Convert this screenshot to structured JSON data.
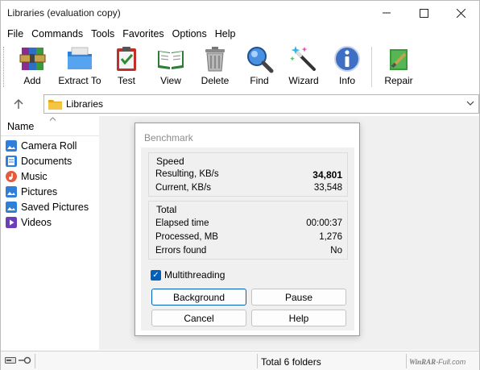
{
  "window": {
    "title": "Libraries (evaluation copy)"
  },
  "menu": [
    "File",
    "Commands",
    "Tools",
    "Favorites",
    "Options",
    "Help"
  ],
  "toolbar": [
    {
      "label": "Add",
      "icon": "add-archive-icon"
    },
    {
      "label": "Extract To",
      "icon": "extract-folder-icon"
    },
    {
      "label": "Test",
      "icon": "test-clipboard-icon"
    },
    {
      "label": "View",
      "icon": "view-book-icon"
    },
    {
      "label": "Delete",
      "icon": "trash-can-icon"
    },
    {
      "label": "Find",
      "icon": "magnifier-icon"
    },
    {
      "label": "Wizard",
      "icon": "magic-wand-icon"
    },
    {
      "label": "Info",
      "icon": "info-icon"
    },
    {
      "label": "Repair",
      "icon": "repair-kit-icon"
    }
  ],
  "address": {
    "path": "Libraries"
  },
  "list": {
    "header": "Name",
    "items": [
      {
        "name": "Camera Roll",
        "icon": "pictures-library-icon"
      },
      {
        "name": "Documents",
        "icon": "documents-library-icon"
      },
      {
        "name": "Music",
        "icon": "music-library-icon"
      },
      {
        "name": "Pictures",
        "icon": "pictures-library-icon"
      },
      {
        "name": "Saved Pictures",
        "icon": "pictures-library-icon"
      },
      {
        "name": "Videos",
        "icon": "videos-library-icon"
      }
    ]
  },
  "status": {
    "text": "Total 6 folders",
    "watermark_brand": "WinRAR",
    "watermark_suffix": "-Full.com"
  },
  "benchmark": {
    "title": "Benchmark",
    "speed": {
      "heading": "Speed",
      "resulting_label": "Resulting, KB/s",
      "resulting_value": "34,801",
      "current_label": "Current, KB/s",
      "current_value": "33,548"
    },
    "total": {
      "heading": "Total",
      "elapsed_label": "Elapsed time",
      "elapsed_value": "00:00:37",
      "processed_label": "Processed, MB",
      "processed_value": "1,276",
      "errors_label": "Errors found",
      "errors_value": "No"
    },
    "multithreading_label": "Multithreading",
    "multithreading_checked": true,
    "buttons": {
      "background": "Background",
      "pause": "Pause",
      "cancel": "Cancel",
      "help": "Help"
    }
  },
  "colors": {
    "accent": "#005fb8",
    "pane_bg": "#f0f0f0",
    "folder_yellow": "#f4c542"
  }
}
